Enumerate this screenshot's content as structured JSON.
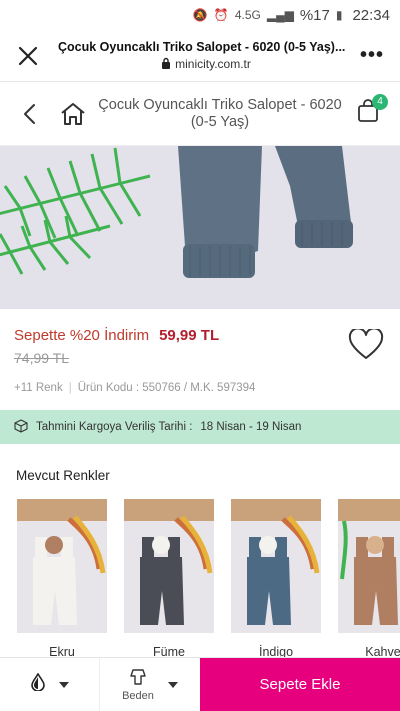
{
  "status": {
    "network": "4.5G",
    "battery": "%17",
    "time": "22:34"
  },
  "browser": {
    "page_title": "Çocuk Oyuncaklı Triko Salopet - 6020 (0-5 Yaş)...",
    "url": "minicity.com.tr"
  },
  "header": {
    "product_title": "Çocuk Oyuncaklı Triko Salopet - 6020 (0-5 Yaş)",
    "cart_count": "4"
  },
  "price": {
    "discount_label": "Sepette %20 İndirim",
    "current_price": "59,99 TL",
    "old_price": "74,99 TL"
  },
  "meta": {
    "colors_count": "+11 Renk",
    "product_code": "Ürün Kodu : 550766 / M.K. 597394"
  },
  "cargo": {
    "label": "Tahmini Kargoya Veriliş Tarihi :",
    "dates": "18 Nisan - 19 Nisan"
  },
  "colors": {
    "title": "Mevcut Renkler",
    "items": [
      {
        "name": "Ekru",
        "hex": "#f4f2ee"
      },
      {
        "name": "Füme",
        "hex": "#4a4d55"
      },
      {
        "name": "İndigo",
        "hex": "#4d6a85"
      },
      {
        "name": "Kahve",
        "hex": "#b07f62"
      }
    ]
  },
  "bottom": {
    "size_label": "Beden",
    "add_to_cart": "Sepete Ekle"
  },
  "theme": {
    "accent": "#e6007e",
    "price_red": "#b21f2d",
    "cargo_bg": "#bfe8d2",
    "badge_green": "#2bb673"
  }
}
